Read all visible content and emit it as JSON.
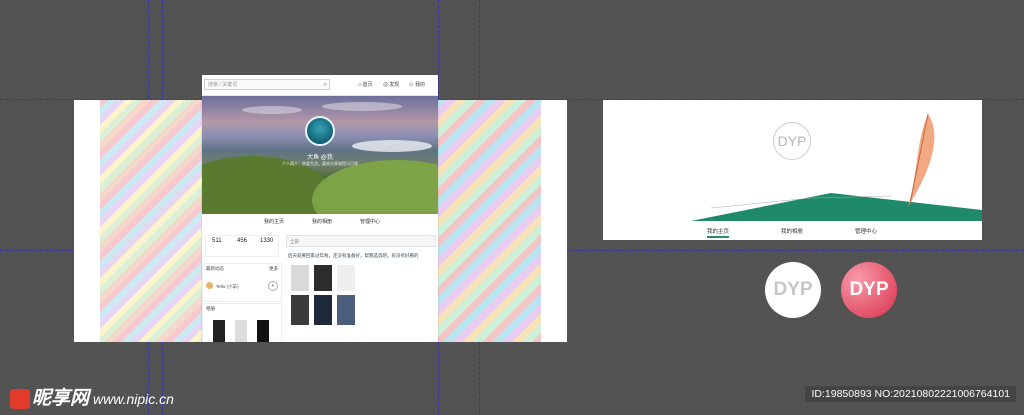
{
  "canvas": {
    "background": "#535353",
    "guide_color": "#2b2bd0"
  },
  "mockup": {
    "search_placeholder": "搜索 / 关键词",
    "nav_items": [
      {
        "icon": "home-icon",
        "label": "首页"
      },
      {
        "icon": "discover-icon",
        "label": "发现"
      },
      {
        "icon": "user-icon",
        "label": "我的"
      }
    ],
    "profile_name": "大鱼 @我",
    "profile_desc": "个人简介：热爱生活，喜欢分享穿搭与日常",
    "tabs": [
      "我的主页",
      "我的相册",
      "管理中心"
    ],
    "stats": [
      "511",
      "456",
      "1330"
    ],
    "feed_placeholder": "全部",
    "post_text": "后天就要回家过年啦，还没有准备好，帮我选选吧，有没有好看的",
    "sidebar_title": "最新动态",
    "sidebar_item": "Tello (小羊)",
    "sidebar_more": "更多",
    "sidebar_title2": "相册"
  },
  "right": {
    "logo_text": "DYP",
    "tabs": [
      "我的主页",
      "我的相册",
      "管理中心"
    ],
    "active_tab_color": "#2a8a6b"
  },
  "watermark": {
    "brand": "昵享网",
    "url": "www.nipic.cn",
    "id_text": "ID:19850893 NO:20210802221006764101"
  }
}
